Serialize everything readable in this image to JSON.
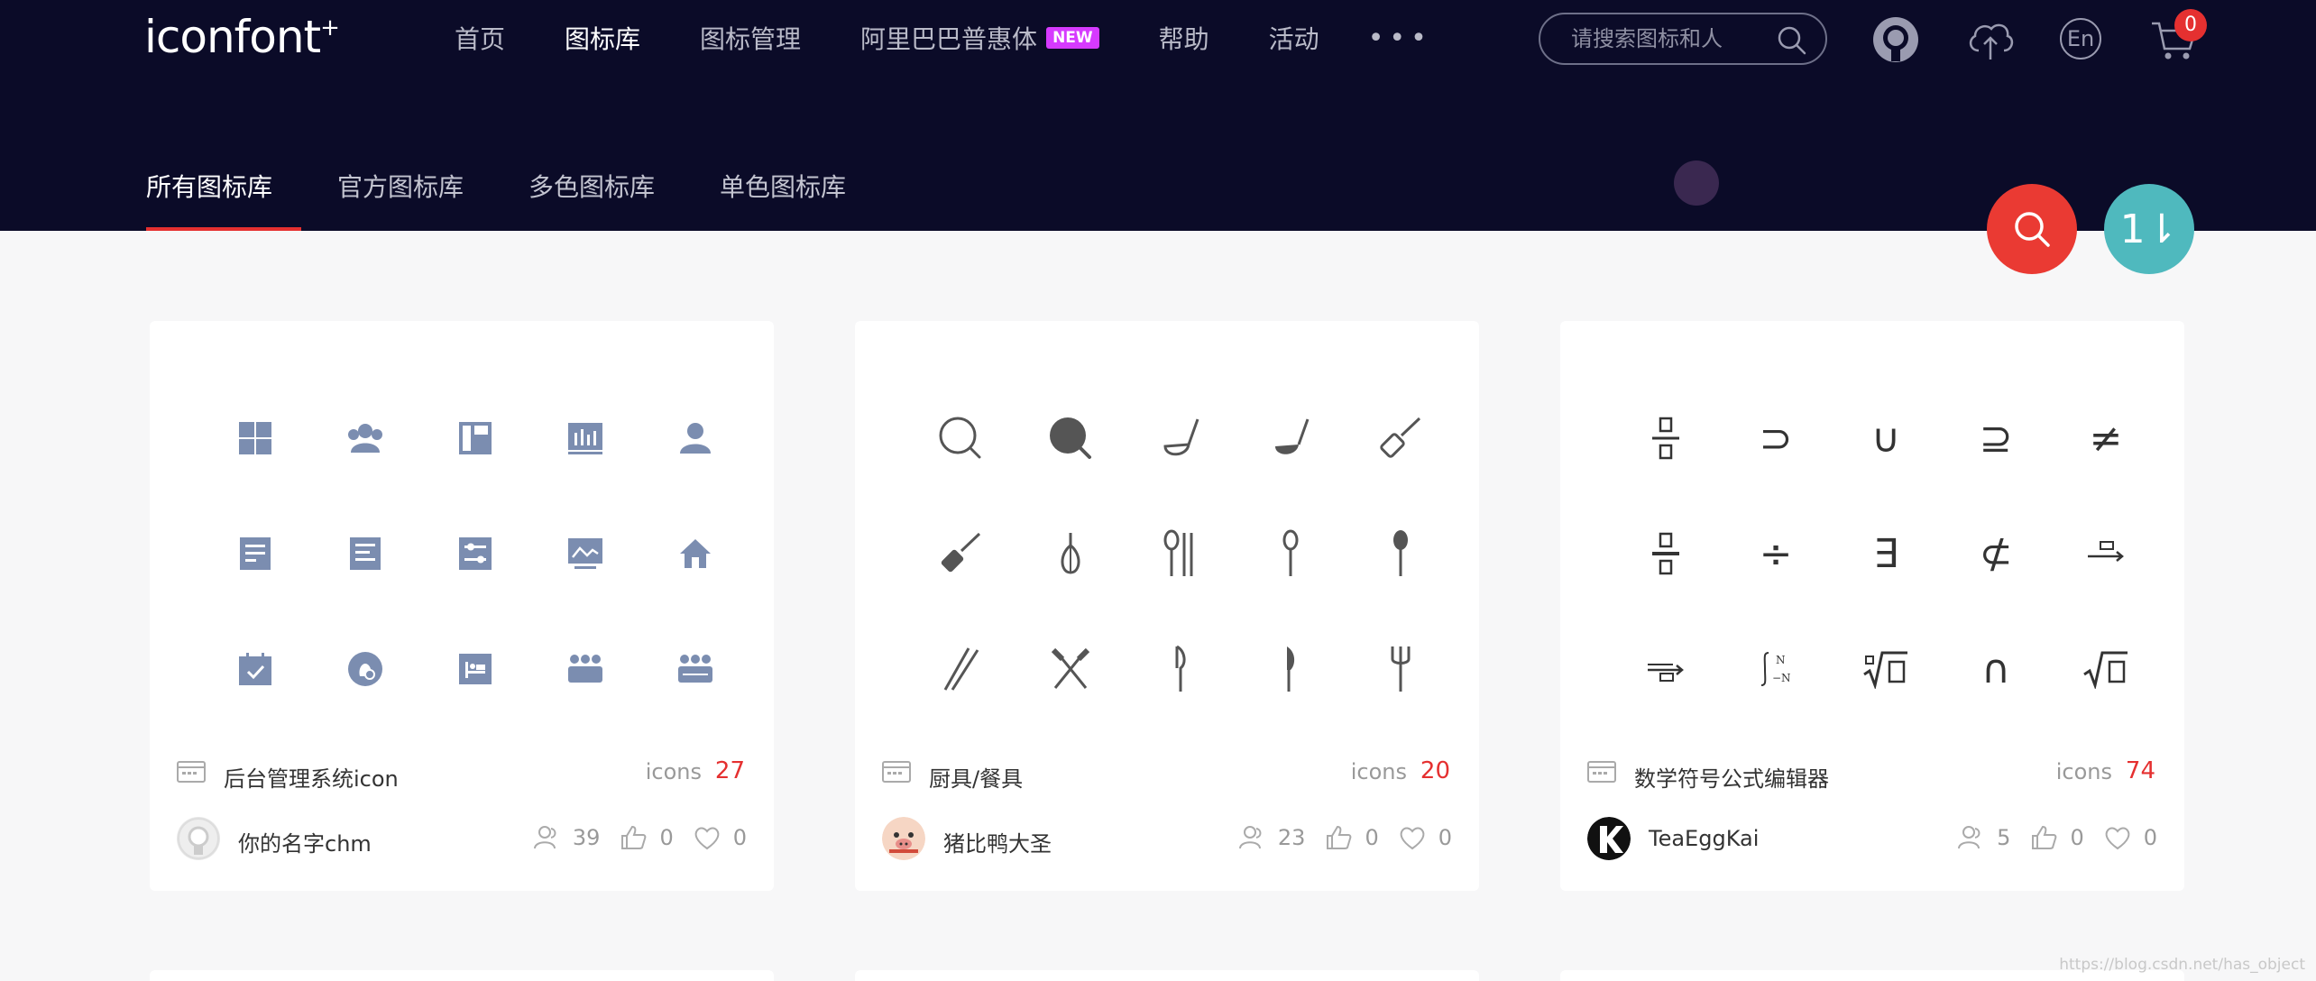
{
  "logo": {
    "text": "iconfont",
    "plus": "+"
  },
  "nav": {
    "items": [
      {
        "label": "首页"
      },
      {
        "label": "图标库",
        "active": true
      },
      {
        "label": "图标管理"
      },
      {
        "label": "阿里巴巴普惠体",
        "badge": "NEW"
      },
      {
        "label": "帮助"
      },
      {
        "label": "活动"
      }
    ],
    "more": "•••"
  },
  "search": {
    "placeholder": "请搜索图标和人"
  },
  "user_icons": [
    "github-icon",
    "upload-cloud-icon",
    "language-icon",
    "cart-icon"
  ],
  "lang_label": "En",
  "cart_count": "0",
  "subtabs": [
    {
      "label": "所有图标库",
      "active": true
    },
    {
      "label": "官方图标库"
    },
    {
      "label": "多色图标库"
    },
    {
      "label": "单色图标库"
    }
  ],
  "fabs": {
    "sort_label": "1⇂"
  },
  "cards": [
    {
      "title": "后台管理系统icon",
      "icons_label": "icons",
      "icons_count": "27",
      "author": "你的名字chm",
      "followers": "39",
      "likes": "0",
      "favorites": "0",
      "icon_color": "#7b8db0"
    },
    {
      "title": "厨具/餐具",
      "icons_label": "icons",
      "icons_count": "20",
      "author": "猪比鸭大圣",
      "followers": "23",
      "likes": "0",
      "favorites": "0",
      "icon_color": "#555555"
    },
    {
      "title": "数学符号公式编辑器",
      "icons_label": "icons",
      "icons_count": "74",
      "author": "TeaEggKai",
      "followers": "5",
      "likes": "0",
      "favorites": "0",
      "icon_color": "#333333"
    }
  ],
  "math_symbols": [
    "⊃",
    "∪",
    "⊇",
    "≠",
    "÷",
    "∃",
    "⊄",
    "∩"
  ],
  "watermark": "https://blog.csdn.net/has_object",
  "colors": {
    "header_bg": "#0b0b28",
    "accent_red": "#ea3a33",
    "accent_teal": "#4fb9be"
  }
}
